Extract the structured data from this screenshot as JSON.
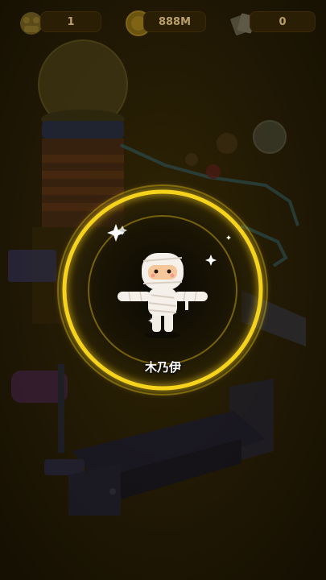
{
  "hud": {
    "left_value": "1",
    "middle_value": "888M",
    "right_value": "0",
    "left_icon": "character-icon",
    "middle_icon": "coin-icon",
    "right_icon": "tickets-icon"
  },
  "reveal": {
    "character_name": "木乃伊",
    "character_icon": "mummy-character",
    "ring_color": "#f5d21c"
  }
}
